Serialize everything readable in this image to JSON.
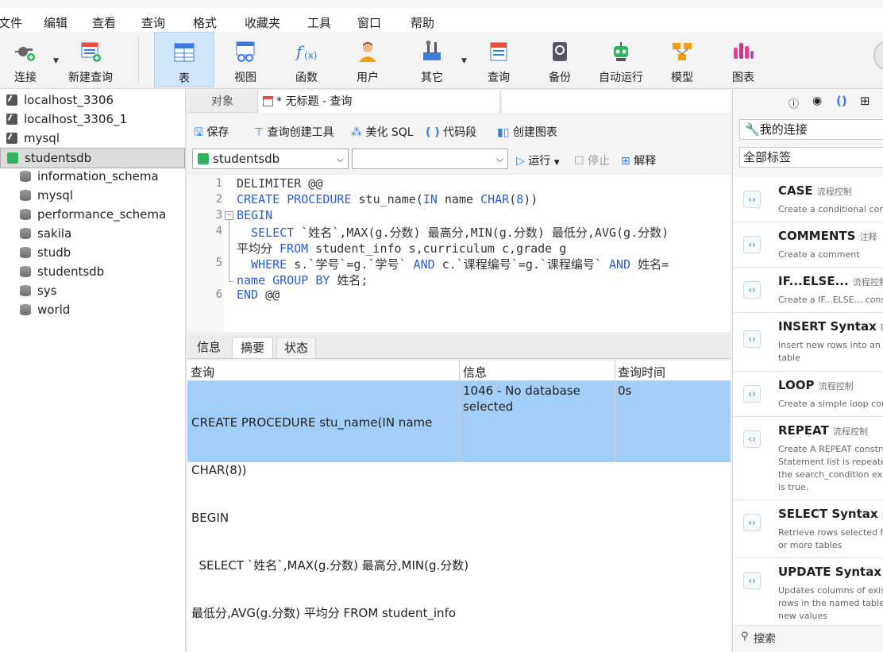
{
  "menu": [
    "文件",
    "编辑",
    "查看",
    "查询",
    "格式",
    "收藏夹",
    "工具",
    "窗口",
    "帮助"
  ],
  "toolbar": {
    "connect": "连接",
    "new_query": "新建查询",
    "table": "表",
    "view": "视图",
    "function": "函数",
    "user": "用户",
    "other": "其它",
    "query": "查询",
    "backup": "备份",
    "automation": "自动运行",
    "model": "模型",
    "chart": "图表"
  },
  "tree": [
    "localhost_3306",
    "localhost_3306_1",
    "mysql",
    "studentsdb",
    "information_schema",
    "mysql",
    "performance_schema",
    "sakila",
    "studb",
    "studentsdb",
    "sys",
    "world"
  ],
  "tabs": {
    "objects": "对象",
    "query_tab": "* 无标题 - 查询"
  },
  "edit_toolbar": {
    "save": "保存",
    "builder": "查询创建工具",
    "beautify": "美化 SQL",
    "snippet": "代码段",
    "create_chart": "创建图表"
  },
  "selectors": {
    "db": "studentsdb",
    "schema": "",
    "run": "运行",
    "stop": "停止",
    "explain": "解释"
  },
  "editor": {
    "line_numbers": [
      "1",
      "2",
      "3",
      "4",
      "5",
      "6"
    ],
    "l1": "DELIMITER @@",
    "l2a": "CREATE PROCEDURE",
    "l2b": " stu_name(",
    "l2c": "IN",
    "l2d": " name ",
    "l2e": "CHAR",
    "l2f": "(",
    "l2g": "8",
    "l2h": "))",
    "l3": "BEGIN",
    "l4a": "  SELECT",
    "l4b": " `姓名`,MAX(g.分数) 最高分,MIN(g.分数) 最低分,AVG(g.分数)",
    "l4c": "平均分 ",
    "l4d": "FROM",
    "l4e": " student_info s,curriculum c,grade g",
    "l5a": "  WHERE",
    "l5b": " s.`学号`=g.`学号` ",
    "l5c": "AND",
    "l5d": " c.`课程编号`=g.`课程编号` ",
    "l5e": "AND",
    "l5f": " 姓名=",
    "l5g": "name ",
    "l5h": "GROUP BY",
    "l5i": " 姓名;",
    "l6a": "END",
    "l6b": " @@"
  },
  "result_tabs": {
    "info": "信息",
    "summary": "摘要",
    "status": "状态"
  },
  "result": {
    "headers": {
      "query": "查询",
      "info": "信息",
      "time": "查询时间"
    },
    "query_lines": [
      "CREATE PROCEDURE stu_name(IN name",
      "CHAR(8))",
      "BEGIN",
      "  SELECT `姓名`,MAX(g.分数) 最高分,MIN(g.分数)",
      "最低分,AVG(g.分数) 平均分 FROM student_info"
    ],
    "info_lines": [
      "1046 - No database",
      "selected"
    ],
    "time": "0s"
  },
  "right": {
    "my_connection": "我的连接",
    "all_tags": "全部标签",
    "search": "搜索",
    "snippets": [
      {
        "title": "CASE",
        "tag": "流程控制",
        "desc": "Create a conditional const"
      },
      {
        "title": "COMMENTS",
        "tag": "注释",
        "desc": "Create a comment"
      },
      {
        "title": "IF...ELSE...",
        "tag": "流程控制",
        "desc": "Create a IF...ELSE... constru"
      },
      {
        "title": "INSERT Syntax",
        "tag": "DM",
        "desc": "Insert new rows into an ex\ntable"
      },
      {
        "title": "LOOP",
        "tag": "流程控制",
        "desc": "Create a simple loop cons"
      },
      {
        "title": "REPEAT",
        "tag": "流程控制",
        "desc": "Create A REPEAT construc\nStatement list is repeated\nthe search_condition expr\nis true."
      },
      {
        "title": "SELECT Syntax",
        "tag": "DM",
        "desc": "Retrieve rows selected fro\nor more tables"
      },
      {
        "title": "UPDATE Syntax",
        "tag": "DI",
        "desc": "Updates columns of existi\nrows in the named table w\nnew values"
      }
    ]
  },
  "colors": {
    "accent": "#2a5bd7",
    "selection": "#a3cef8",
    "active_tool": "#cfe6fb"
  }
}
